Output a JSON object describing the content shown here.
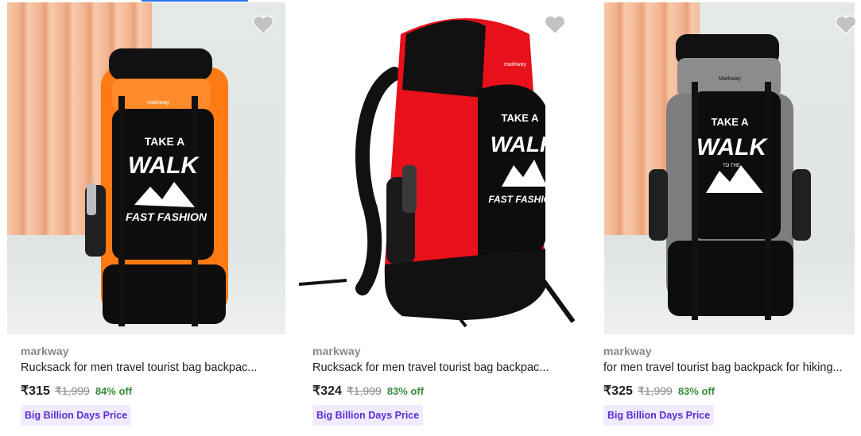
{
  "products": [
    {
      "brand": "markway",
      "title": "Rucksack for men travel tourist bag backpac...",
      "price": "₹315",
      "mrp": "₹1,999",
      "discount": "84% off",
      "offer": "Big Billion Days Price",
      "bag_color": "orange",
      "bag_text": [
        "TAKE A",
        "WALK",
        "FAST FASHION"
      ],
      "logo": "markway"
    },
    {
      "brand": "markway",
      "title": "Rucksack for men travel tourist bag backpac...",
      "price": "₹324",
      "mrp": "₹1,999",
      "discount": "83% off",
      "offer": "Big Billion Days Price",
      "bag_color": "red",
      "bag_text": [
        "TAKE A",
        "WALK",
        "FAST FASHION"
      ],
      "logo": "markway"
    },
    {
      "brand": "markway",
      "title": "for men travel tourist bag backpack for hiking...",
      "price": "₹325",
      "mrp": "₹1,999",
      "discount": "83% off",
      "offer": "Big Billion Days Price",
      "bag_color": "grey",
      "bag_text": [
        "TAKE A",
        "WALK",
        "TO THE"
      ],
      "logo": "Markway"
    }
  ],
  "colors": {
    "accent": "#2874f0",
    "discount": "#388e3c",
    "offer_text": "#5b2ed1",
    "offer_bg": "#f1ebff",
    "orange": "#ff7a12",
    "red": "#e8101b",
    "grey": "#7d7d7f"
  },
  "icons": {
    "wishlist": "heart-icon"
  }
}
